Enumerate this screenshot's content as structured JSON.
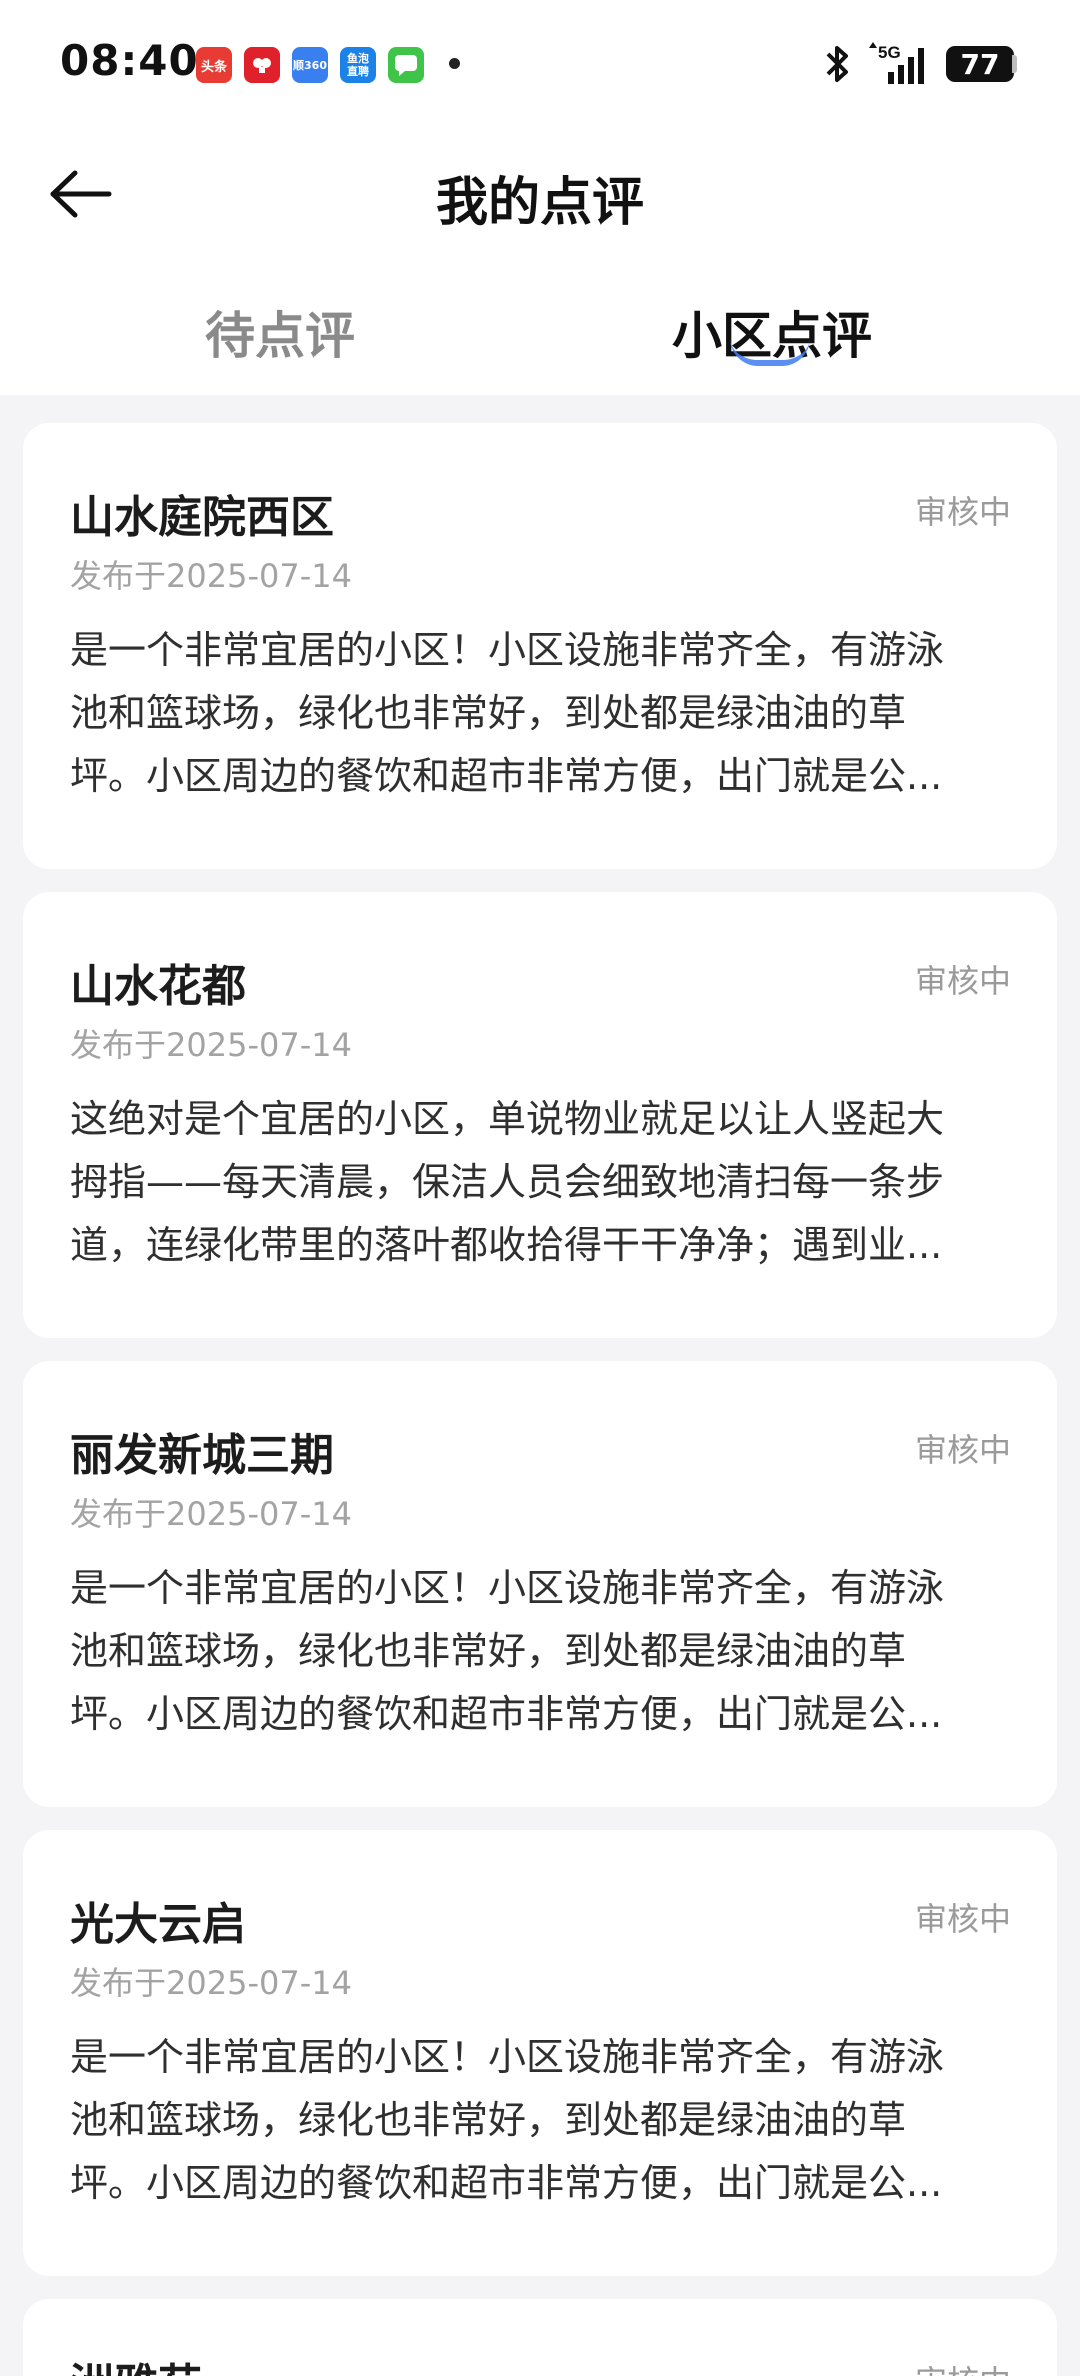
{
  "status_bar": {
    "time": "08:40",
    "battery": "77",
    "notification_icons": [
      {
        "name": "toutiao-app-icon",
        "label": "头条",
        "color": "#e83b34"
      },
      {
        "name": "pinduoduo-app-icon",
        "label": "",
        "color": "#e0202a"
      },
      {
        "name": "app-360-icon",
        "label": "顺360",
        "color": "#3a7ff0"
      },
      {
        "name": "yupao-app-icon",
        "label": "鱼泡直聘",
        "color": "#1d82e8"
      },
      {
        "name": "messages-app-icon",
        "label": "",
        "color": "#3fc449"
      }
    ]
  },
  "header": {
    "title": "我的点评"
  },
  "tabs": [
    {
      "label": "待点评",
      "active": false
    },
    {
      "label": "小区点评",
      "active": true
    }
  ],
  "colors": {
    "accent": "#3f7cf0",
    "background": "#f4f4f6",
    "card": "#ffffff",
    "status_text": "#9a9a9a"
  },
  "reviews": [
    {
      "title": "山水庭院西区",
      "status": "审核中",
      "date": "发布于2025-07-14",
      "lines": [
        "是一个非常宜居的小区！小区设施非常齐全，有游泳",
        "池和篮球场，绿化也非常好，到处都是绿油油的草",
        "坪。小区周边的餐饮和超市非常方便，出门就是公..."
      ]
    },
    {
      "title": "山水花都",
      "status": "审核中",
      "date": "发布于2025-07-14",
      "lines": [
        "这绝对是个宜居的小区，单说物业就足以让人竖起大",
        "拇指——每天清晨，保洁人员会细致地清扫每一条步",
        "道，连绿化带里的落叶都收拾得干干净净；遇到业..."
      ]
    },
    {
      "title": "丽发新城三期",
      "status": "审核中",
      "date": "发布于2025-07-14",
      "lines": [
        "是一个非常宜居的小区！小区设施非常齐全，有游泳",
        "池和篮球场，绿化也非常好，到处都是绿油油的草",
        "坪。小区周边的餐饮和超市非常方便，出门就是公..."
      ]
    },
    {
      "title": "光大云启",
      "status": "审核中",
      "date": "发布于2025-07-14",
      "lines": [
        "是一个非常宜居的小区！小区设施非常齐全，有游泳",
        "池和篮球场，绿化也非常好，到处都是绿油油的草",
        "坪。小区周边的餐饮和超市非常方便，出门就是公..."
      ]
    },
    {
      "title": "洲雅苑",
      "status": "审核中",
      "date": "",
      "lines": []
    }
  ]
}
